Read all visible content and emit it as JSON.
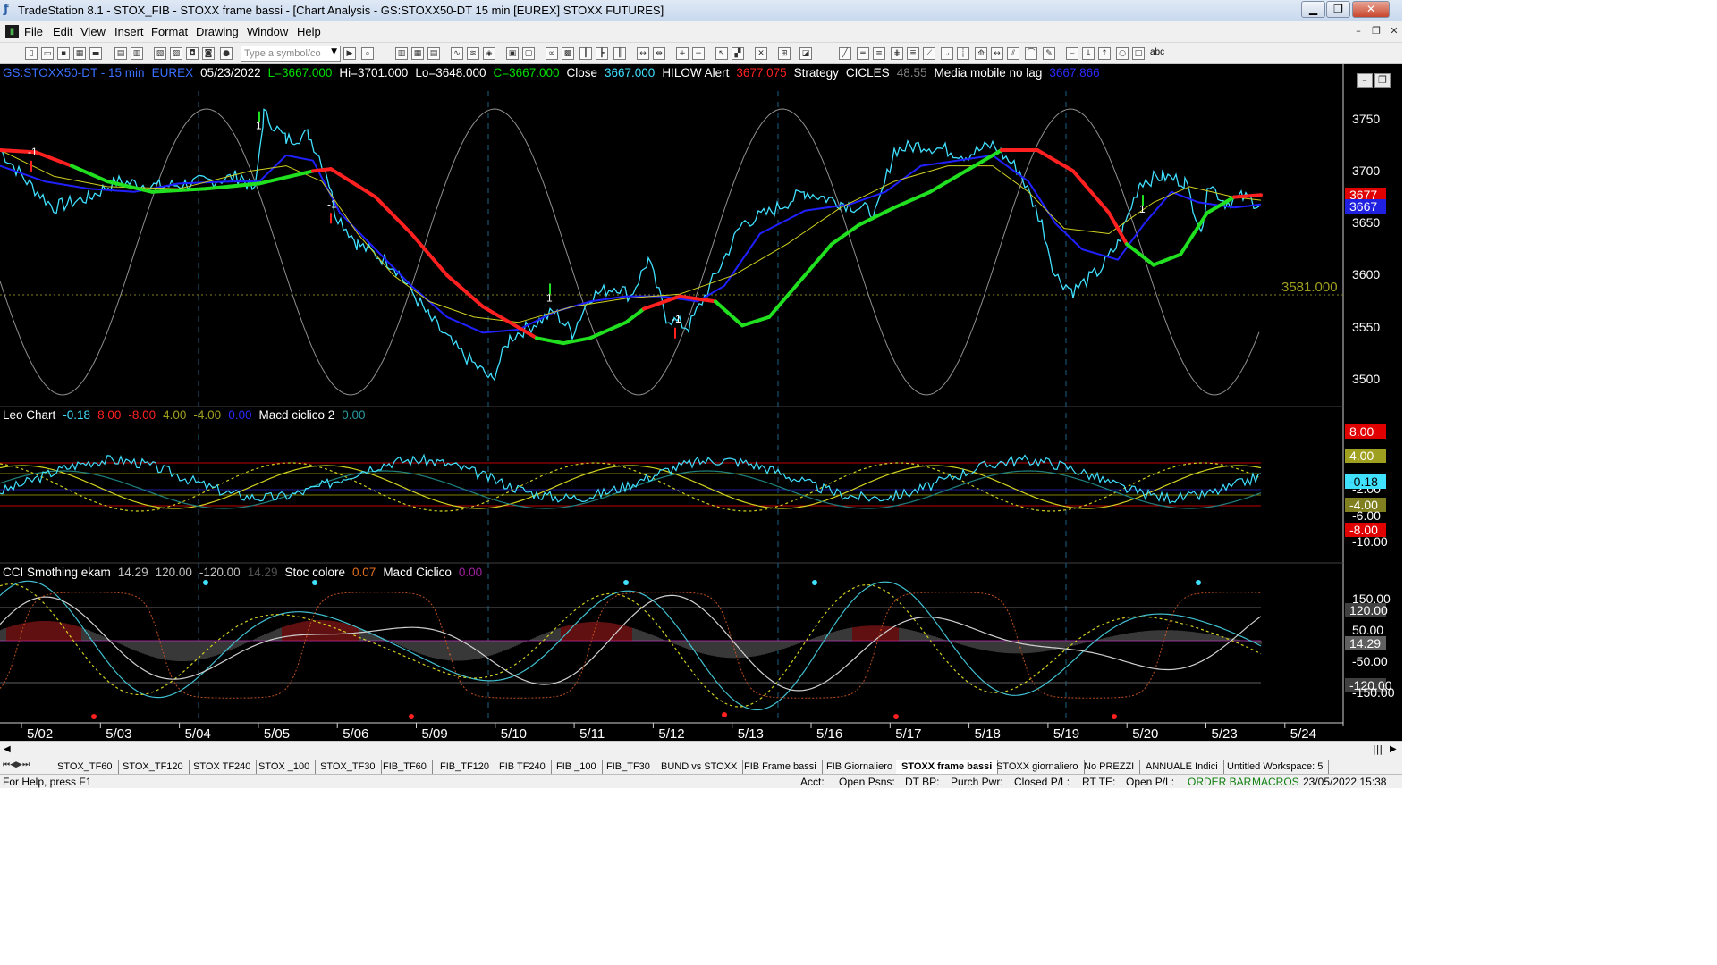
{
  "title": "TradeStation 8.1 - STOX_FIB - STOXX frame bassi - [Chart Analysis - GS:STOXX50-DT  15 min  [EUREX] STOXX FUTURES]",
  "menu": [
    "File",
    "Edit",
    "View",
    "Insert",
    "Format",
    "Drawing",
    "Window",
    "Help"
  ],
  "toolbar": {
    "symbol_placeholder": "Type a symbol/co",
    "abc_label": "abc"
  },
  "price_header": [
    {
      "text": "GS:STOXX50-DT - 15 min",
      "color": "#3a6fff"
    },
    {
      "text": "EUREX",
      "color": "#3a6fff"
    },
    {
      "text": "05/23/2022",
      "color": "#ffffff"
    },
    {
      "text": "L=3667.000",
      "color": "#00e000"
    },
    {
      "text": "Hi=3701.000",
      "color": "#ffffff"
    },
    {
      "text": "Lo=3648.000",
      "color": "#ffffff"
    },
    {
      "text": "C=3667.000",
      "color": "#00e000"
    },
    {
      "text": "Close",
      "color": "#ffffff"
    },
    {
      "text": "3667.000",
      "color": "#40e0ff"
    },
    {
      "text": "HILOW Alert",
      "color": "#ffffff"
    },
    {
      "text": "3677.075",
      "color": "#ff2020"
    },
    {
      "text": "Strategy",
      "color": "#ffffff"
    },
    {
      "text": "CICLES",
      "color": "#ffffff"
    },
    {
      "text": "48.55",
      "color": "#808080"
    },
    {
      "text": "Media mobile no lag",
      "color": "#ffffff"
    },
    {
      "text": "3667.866",
      "color": "#2a2aff"
    }
  ],
  "leo_header": [
    {
      "text": "Leo Chart",
      "color": "#ffffff"
    },
    {
      "text": "-0.18",
      "color": "#40e0ff"
    },
    {
      "text": "8.00",
      "color": "#ff2020"
    },
    {
      "text": "-8.00",
      "color": "#ff2020"
    },
    {
      "text": "4.00",
      "color": "#a0a020"
    },
    {
      "text": "-4.00",
      "color": "#a0a020"
    },
    {
      "text": "0.00",
      "color": "#2a2aff"
    },
    {
      "text": "Macd ciclico 2",
      "color": "#ffffff"
    },
    {
      "text": "0.00",
      "color": "#2a9aa0"
    }
  ],
  "cci_header": [
    {
      "text": "CCI Smothing ekam",
      "color": "#ffffff"
    },
    {
      "text": "14.29",
      "color": "#c0c0c0"
    },
    {
      "text": "120.00",
      "color": "#c0c0c0"
    },
    {
      "text": "-120.00",
      "color": "#c0c0c0"
    },
    {
      "text": "14.29",
      "color": "#505050"
    },
    {
      "text": "Stoc colore",
      "color": "#ffffff"
    },
    {
      "text": "0.07",
      "color": "#e07020"
    },
    {
      "text": "Macd Ciclico",
      "color": "#ffffff"
    },
    {
      "text": "0.00",
      "color": "#a020a0"
    }
  ],
  "price_axis": [
    "3750",
    "3700",
    "3650",
    "3600",
    "3550",
    "3500"
  ],
  "price_tags": {
    "red": "3677",
    "blue": "3667",
    "level": "3581.000"
  },
  "leo_axis": [
    "-2.00",
    "-6.00",
    "-10.00"
  ],
  "leo_tags": {
    "red_top": "8.00",
    "olive_top": "4.00",
    "cyan": "-0.18",
    "olive_bottom": "-4.00",
    "red_bottom": "-8.00"
  },
  "cci_axis": [
    "150.00",
    "50.00",
    "-50.00",
    "-150.00"
  ],
  "cci_tags": {
    "top": "120.00",
    "mid": "14.29",
    "bottom": "-120.00"
  },
  "dates": [
    "5/02",
    "5/03",
    "5/04",
    "5/05",
    "5/06",
    "5/09",
    "5/10",
    "5/11",
    "5/12",
    "5/13",
    "5/16",
    "5/17",
    "5/18",
    "5/19",
    "5/20",
    "5/23",
    "5/24"
  ],
  "signals": [
    {
      "text": "-1",
      "dir": "down"
    },
    {
      "text": "1",
      "dir": "up"
    },
    {
      "text": "-1",
      "dir": "down"
    },
    {
      "text": "1",
      "dir": "up"
    },
    {
      "text": "-1",
      "dir": "down"
    },
    {
      "text": "1",
      "dir": "up"
    }
  ],
  "tabs": [
    "STOX_TF60",
    "STOX_TF120",
    "STOX TF240",
    "STOX _100",
    "STOX_TF30",
    "FIB_TF60",
    "FIB_TF120",
    "FIB TF240",
    "FIB _100",
    "FIB_TF30",
    "BUND vs STOXX",
    "FIB Frame bassi",
    "FIB Giornaliero",
    "STOXX frame bassi",
    "STOXX giornaliero",
    "No PREZZI",
    "ANNUALE Indici",
    "Untitled Workspace:  5"
  ],
  "active_tab": "STOXX frame bassi",
  "status": {
    "help": "For Help, press F1",
    "acct": "Acct:",
    "open_psns": "Open Psns:",
    "dt_bp": "DT BP:",
    "purch_pwr": "Purch Pwr:",
    "closed_pl": "Closed P/L:",
    "rt_te": "RT TE:",
    "open_pl": "Open P/L:",
    "order_bar": "ORDER BAR",
    "macros": "MACROS",
    "datetime": "23/05/2022 15:38"
  }
}
